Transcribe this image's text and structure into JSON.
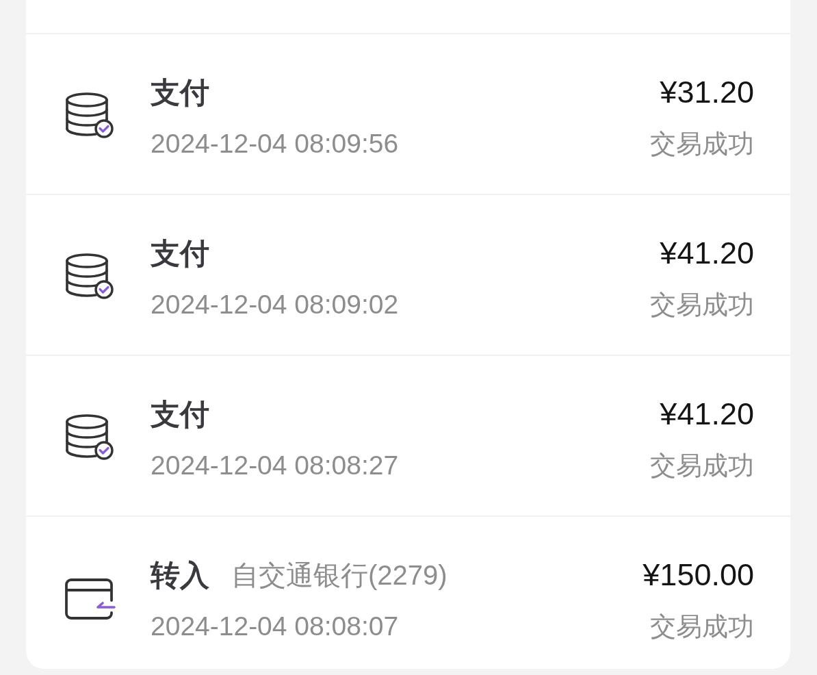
{
  "transactions": [
    {
      "kind": "payment",
      "title": "支付",
      "date": "2024-12-04 08:09:56",
      "amount": "¥31.20",
      "status": "交易成功"
    },
    {
      "kind": "payment",
      "title": "支付",
      "date": "2024-12-04 08:09:02",
      "amount": "¥41.20",
      "status": "交易成功"
    },
    {
      "kind": "payment",
      "title": "支付",
      "date": "2024-12-04 08:08:27",
      "amount": "¥41.20",
      "status": "交易成功"
    },
    {
      "kind": "transfer_in",
      "title": "转入",
      "source": "自交通银行(2279)",
      "date": "2024-12-04 08:08:07",
      "amount": "¥150.00",
      "status": "交易成功"
    }
  ]
}
